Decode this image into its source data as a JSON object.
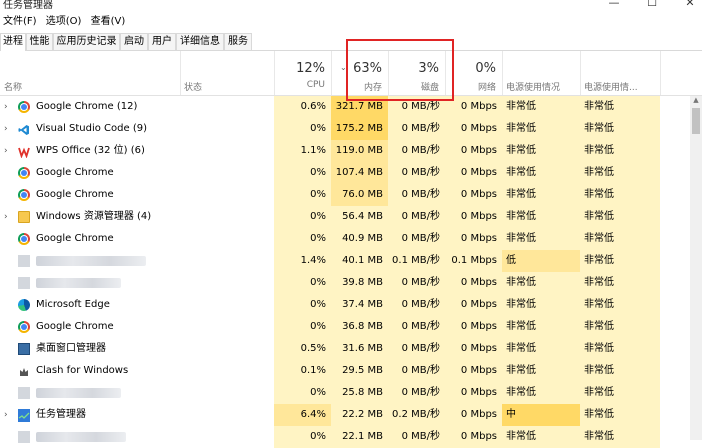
{
  "window": {
    "title": "任务管理器",
    "minimize": "—",
    "maximize": "☐",
    "close": "✕"
  },
  "menu": [
    "文件(F)",
    "选项(O)",
    "查看(V)"
  ],
  "tabs": [
    "进程",
    "性能",
    "应用历史记录",
    "启动",
    "用户",
    "详细信息",
    "服务"
  ],
  "columns": {
    "name": "名称",
    "status": "状态",
    "cpu": {
      "pct": "12%",
      "label": "CPU"
    },
    "memory": {
      "pct": "63%",
      "label": "内存"
    },
    "disk": {
      "pct": "3%",
      "label": "磁盘"
    },
    "network": {
      "pct": "0%",
      "label": "网络"
    },
    "power": "电源使用情况",
    "power_trend": "电源使用情..."
  },
  "rows": [
    {
      "expand": "›",
      "icon": "chrome-icon",
      "name": "Google Chrome (12)",
      "cpu": "0.6%",
      "mem": "321.7 MB",
      "disk": "0 MB/秒",
      "net": "0 Mbps",
      "power": "非常低",
      "power_trend": "非常低"
    },
    {
      "expand": "›",
      "icon": "visual-studio-code-icon",
      "name": "Visual Studio Code (9)",
      "cpu": "0%",
      "mem": "175.2 MB",
      "disk": "0 MB/秒",
      "net": "0 Mbps",
      "power": "非常低",
      "power_trend": "非常低"
    },
    {
      "expand": "›",
      "icon": "wps-office-icon",
      "name": "WPS Office (32 位) (6)",
      "cpu": "1.1%",
      "mem": "119.0 MB",
      "disk": "0 MB/秒",
      "net": "0 Mbps",
      "power": "非常低",
      "power_trend": "非常低"
    },
    {
      "expand": "",
      "icon": "chrome-icon",
      "name": "Google Chrome",
      "cpu": "0%",
      "mem": "107.4 MB",
      "disk": "0 MB/秒",
      "net": "0 Mbps",
      "power": "非常低",
      "power_trend": "非常低"
    },
    {
      "expand": "",
      "icon": "chrome-icon",
      "name": "Google Chrome",
      "cpu": "0%",
      "mem": "76.0 MB",
      "disk": "0 MB/秒",
      "net": "0 Mbps",
      "power": "非常低",
      "power_trend": "非常低"
    },
    {
      "expand": "›",
      "icon": "windows-explorer-icon",
      "name": "Windows 资源管理器 (4)",
      "cpu": "0%",
      "mem": "56.4 MB",
      "disk": "0 MB/秒",
      "net": "0 Mbps",
      "power": "非常低",
      "power_trend": "非常低"
    },
    {
      "expand": "",
      "icon": "chrome-icon",
      "name": "Google Chrome",
      "cpu": "0%",
      "mem": "40.9 MB",
      "disk": "0 MB/秒",
      "net": "0 Mbps",
      "power": "非常低",
      "power_trend": "非常低"
    },
    {
      "expand": "",
      "icon": "blurred-icon",
      "name": "",
      "cpu": "1.4%",
      "mem": "40.1 MB",
      "disk": "0.1 MB/秒",
      "net": "0.1 Mbps",
      "power": "低",
      "power_trend": "非常低"
    },
    {
      "expand": "",
      "icon": "blurred-icon",
      "name": "",
      "cpu": "0%",
      "mem": "39.8 MB",
      "disk": "0 MB/秒",
      "net": "0 Mbps",
      "power": "非常低",
      "power_trend": "非常低"
    },
    {
      "expand": "",
      "icon": "edge-icon",
      "name": "Microsoft Edge",
      "cpu": "0%",
      "mem": "37.4 MB",
      "disk": "0 MB/秒",
      "net": "0 Mbps",
      "power": "非常低",
      "power_trend": "非常低"
    },
    {
      "expand": "",
      "icon": "chrome-icon",
      "name": "Google Chrome",
      "cpu": "0%",
      "mem": "36.8 MB",
      "disk": "0 MB/秒",
      "net": "0 Mbps",
      "power": "非常低",
      "power_trend": "非常低"
    },
    {
      "expand": "",
      "icon": "desktop-window-manager-icon",
      "name": "桌面窗口管理器",
      "cpu": "0.5%",
      "mem": "31.6 MB",
      "disk": "0 MB/秒",
      "net": "0 Mbps",
      "power": "非常低",
      "power_trend": "非常低"
    },
    {
      "expand": "",
      "icon": "clash-icon",
      "name": "Clash for Windows",
      "cpu": "0.1%",
      "mem": "29.5 MB",
      "disk": "0 MB/秒",
      "net": "0 Mbps",
      "power": "非常低",
      "power_trend": "非常低"
    },
    {
      "expand": "",
      "icon": "blurred-icon",
      "name": "",
      "cpu": "0%",
      "mem": "25.8 MB",
      "disk": "0 MB/秒",
      "net": "0 Mbps",
      "power": "非常低",
      "power_trend": "非常低"
    },
    {
      "expand": "›",
      "icon": "task-manager-icon",
      "name": "任务管理器",
      "cpu": "6.4%",
      "mem": "22.2 MB",
      "disk": "0.2 MB/秒",
      "net": "0 Mbps",
      "power": "中",
      "power_trend": "非常低"
    },
    {
      "expand": "",
      "icon": "blurred-icon",
      "name": "",
      "cpu": "0%",
      "mem": "22.1 MB",
      "disk": "0 MB/秒",
      "net": "0 Mbps",
      "power": "非常低",
      "power_trend": "非常低"
    }
  ]
}
